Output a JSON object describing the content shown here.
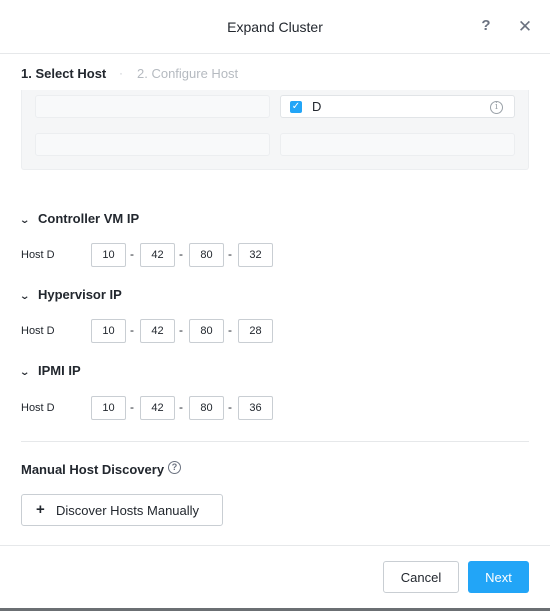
{
  "dialog": {
    "title": "Expand Cluster",
    "help_glyph": "?",
    "close_glyph": "✕"
  },
  "tabs": [
    {
      "label": "1. Select Host",
      "active": true
    },
    {
      "label": "2. Configure Host",
      "active": false
    }
  ],
  "tab_separator": "·",
  "host_grid": {
    "selected_host": {
      "label": "D",
      "checked": true,
      "check_glyph": "✓",
      "info_glyph": "i"
    }
  },
  "sections": [
    {
      "title": "Controller VM IP",
      "collapse_glyph": "⌄",
      "rows": [
        {
          "host": "Host D",
          "octets": [
            "10",
            "42",
            "80",
            "32"
          ]
        }
      ]
    },
    {
      "title": "Hypervisor IP",
      "collapse_glyph": "⌄",
      "rows": [
        {
          "host": "Host D",
          "octets": [
            "10",
            "42",
            "80",
            "28"
          ]
        }
      ]
    },
    {
      "title": "IPMI IP",
      "collapse_glyph": "⌄",
      "rows": [
        {
          "host": "Host D",
          "octets": [
            "10",
            "42",
            "80",
            "36"
          ]
        }
      ]
    }
  ],
  "ip_separator": "-",
  "manual_discovery": {
    "title": "Manual Host Discovery",
    "help_glyph": "?",
    "button_plus": "+",
    "button_label": "Discover Hosts Manually"
  },
  "footer": {
    "cancel_label": "Cancel",
    "next_label": "Next"
  },
  "colors": {
    "accent": "#22a5f7",
    "text": "#22272e",
    "muted_tab": "#b5bac0"
  }
}
